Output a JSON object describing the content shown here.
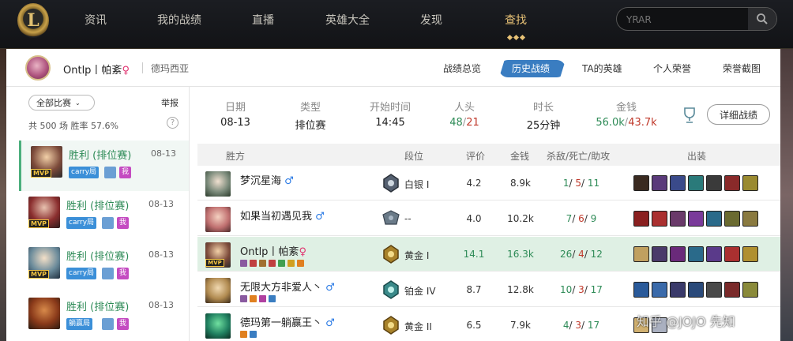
{
  "nav": {
    "items": [
      "资讯",
      "我的战绩",
      "直播",
      "英雄大全",
      "发现",
      "查找"
    ],
    "active_index": 5,
    "search_placeholder": "YRAR"
  },
  "header": {
    "player_name": "Ontlp丨帕紊",
    "gender_symbol": "♀",
    "server": "德玛西亚",
    "tabs": [
      "战绩总览",
      "历史战绩",
      "TA的英雄",
      "个人荣誉",
      "荣誉截图"
    ],
    "active_tab": 1
  },
  "sidebar": {
    "filter_label": "全部比赛",
    "report_label": "举报",
    "summary": "共 500 场  胜率 57.6%",
    "help": "?",
    "matches": [
      {
        "result": "胜利 (排位赛)",
        "date": "08-13",
        "tag": "carry局",
        "wo": "我",
        "mvp": "MVP"
      },
      {
        "result": "胜利 (排位赛)",
        "date": "08-13",
        "tag": "carry局",
        "wo": "我",
        "mvp": "MVP"
      },
      {
        "result": "胜利 (排位赛)",
        "date": "08-13",
        "tag": "carry局",
        "wo": "我",
        "mvp": "MVP"
      },
      {
        "result": "胜利 (排位赛)",
        "date": "08-13",
        "tag": "躺赢局",
        "wo": "我",
        "mvp": ""
      }
    ]
  },
  "summary_row": {
    "headers": [
      "日期",
      "类型",
      "开始时间",
      "人头",
      "时长",
      "金钱"
    ],
    "date": "08-13",
    "type": "排位赛",
    "start_time": "14:45",
    "kills_team": "48",
    "kills_enemy": "21",
    "duration": "25分钟",
    "gold_team": "56.0k",
    "gold_enemy": "43.7k",
    "detail_button": "详细战绩"
  },
  "table": {
    "headers": [
      "胜方",
      "段位",
      "评价",
      "金钱",
      "杀敌/死亡/助攻",
      "出装"
    ],
    "rows": [
      {
        "name": "梦沉星海",
        "gender": "♂",
        "rank": "白银 I",
        "score": "4.2",
        "gold": "8.9k",
        "k": "1",
        "d": "5",
        "a": "11",
        "mvp": ""
      },
      {
        "name": "如果当初遇见我",
        "gender": "♂",
        "rank": "--",
        "score": "4.0",
        "gold": "10.2k",
        "k": "7",
        "d": "6",
        "a": "9",
        "mvp": ""
      },
      {
        "name": "Ontlp丨帕紊",
        "gender": "♀",
        "rank": "黄金 I",
        "score": "14.1",
        "gold": "16.3k",
        "k": "26",
        "d": "4",
        "a": "12",
        "mvp": "MVP"
      },
      {
        "name": "无限大方非爱人丶",
        "gender": "♂",
        "rank": "铂金 IV",
        "score": "8.7",
        "gold": "12.8k",
        "k": "10",
        "d": "3",
        "a": "17",
        "mvp": ""
      },
      {
        "name": "德玛第一躺赢王丶",
        "gender": "♂",
        "rank": "黄金 II",
        "score": "6.5",
        "gold": "7.9k",
        "k": "4",
        "d": "3",
        "a": "17",
        "mvp": ""
      }
    ]
  },
  "watermark": "知乎 @JOJO 先知",
  "colors": {
    "win": "#2e8b57",
    "loss": "#c0392b",
    "accent": "#3a7dc1",
    "gold_nav": "#e8c276",
    "highlight_row": "#dff0e4"
  }
}
